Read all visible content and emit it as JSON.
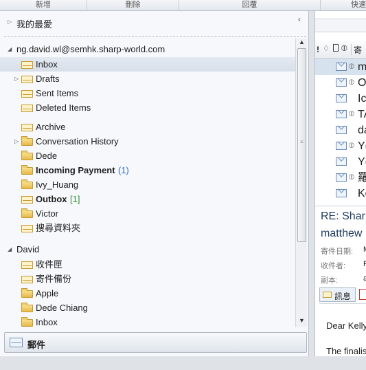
{
  "toolbar": {
    "buttons": [
      "新增",
      "刪除",
      "回覆",
      "快速"
    ]
  },
  "favorites": {
    "label": "我的最愛"
  },
  "account1": {
    "name": "ng.david.wl@semhk.sharp-world.com",
    "folders": [
      {
        "label": "Inbox",
        "count": "",
        "icon": "inbox-icon",
        "bold": false,
        "expander": false
      },
      {
        "label": "Drafts",
        "count": "",
        "icon": "drafts-icon",
        "bold": false,
        "expander": true
      },
      {
        "label": "Sent Items",
        "count": "",
        "icon": "sent-items-icon",
        "bold": false,
        "expander": false
      },
      {
        "label": "Deleted Items",
        "count": "",
        "icon": "deleted-items-icon",
        "bold": false,
        "expander": false
      },
      {
        "label": "Archive",
        "count": "",
        "icon": "archive-icon",
        "bold": false,
        "expander": false
      },
      {
        "label": "Conversation History",
        "count": "",
        "icon": "folder-icon",
        "bold": false,
        "expander": true
      },
      {
        "label": "Dede",
        "count": "",
        "icon": "folder-icon",
        "bold": false,
        "expander": false
      },
      {
        "label": "Incoming Payment",
        "count": "(1)",
        "icon": "folder-icon",
        "bold": true,
        "expander": false
      },
      {
        "label": "Ivy_Huang",
        "count": "",
        "icon": "folder-icon",
        "bold": false,
        "expander": false
      },
      {
        "label": "Outbox",
        "count": "[1]",
        "icon": "outbox-icon",
        "bold": true,
        "expander": false
      },
      {
        "label": "Victor",
        "count": "",
        "icon": "folder-icon",
        "bold": false,
        "expander": false
      },
      {
        "label": "搜尋資料夾",
        "count": "",
        "icon": "search-folder-icon",
        "bold": false,
        "expander": false
      }
    ]
  },
  "account2": {
    "name": "David",
    "folders": [
      {
        "label": "收件匣",
        "icon": "inbox-icon"
      },
      {
        "label": "寄件備份",
        "icon": "sent-items-icon"
      },
      {
        "label": "Apple",
        "icon": "folder-icon"
      },
      {
        "label": "Dede Chiang",
        "icon": "folder-icon"
      },
      {
        "label": "Inbox",
        "icon": "folder-icon"
      }
    ]
  },
  "mail_button": {
    "label": "郵件"
  },
  "message_list": {
    "header_icons": [
      "!",
      "bell",
      "doc",
      "clip",
      "寄"
    ],
    "rows": [
      {
        "text": "m",
        "attach": true,
        "selected": true
      },
      {
        "text": "O",
        "attach": true
      },
      {
        "text": "Ic",
        "attach": false
      },
      {
        "text": "TA",
        "attach": true
      },
      {
        "text": "da",
        "attach": false,
        "reply": true
      },
      {
        "text": "Y(",
        "attach": true
      },
      {
        "text": "Y(",
        "attach": false
      },
      {
        "text": "羅",
        "attach": true
      },
      {
        "text": "Ke",
        "attach": false
      }
    ]
  },
  "reading_pane": {
    "subject_line1": "RE: Sharp",
    "subject_line2": "matthew",
    "sent_label": "寄件日期:",
    "to_label": "收件者:",
    "cc_label": "副本:",
    "sent_value": "M",
    "to_value": "F",
    "cc_value": "a",
    "tab_message": "訊息",
    "body_line1": "Dear Kelly",
    "body_line2": "The finalis"
  }
}
